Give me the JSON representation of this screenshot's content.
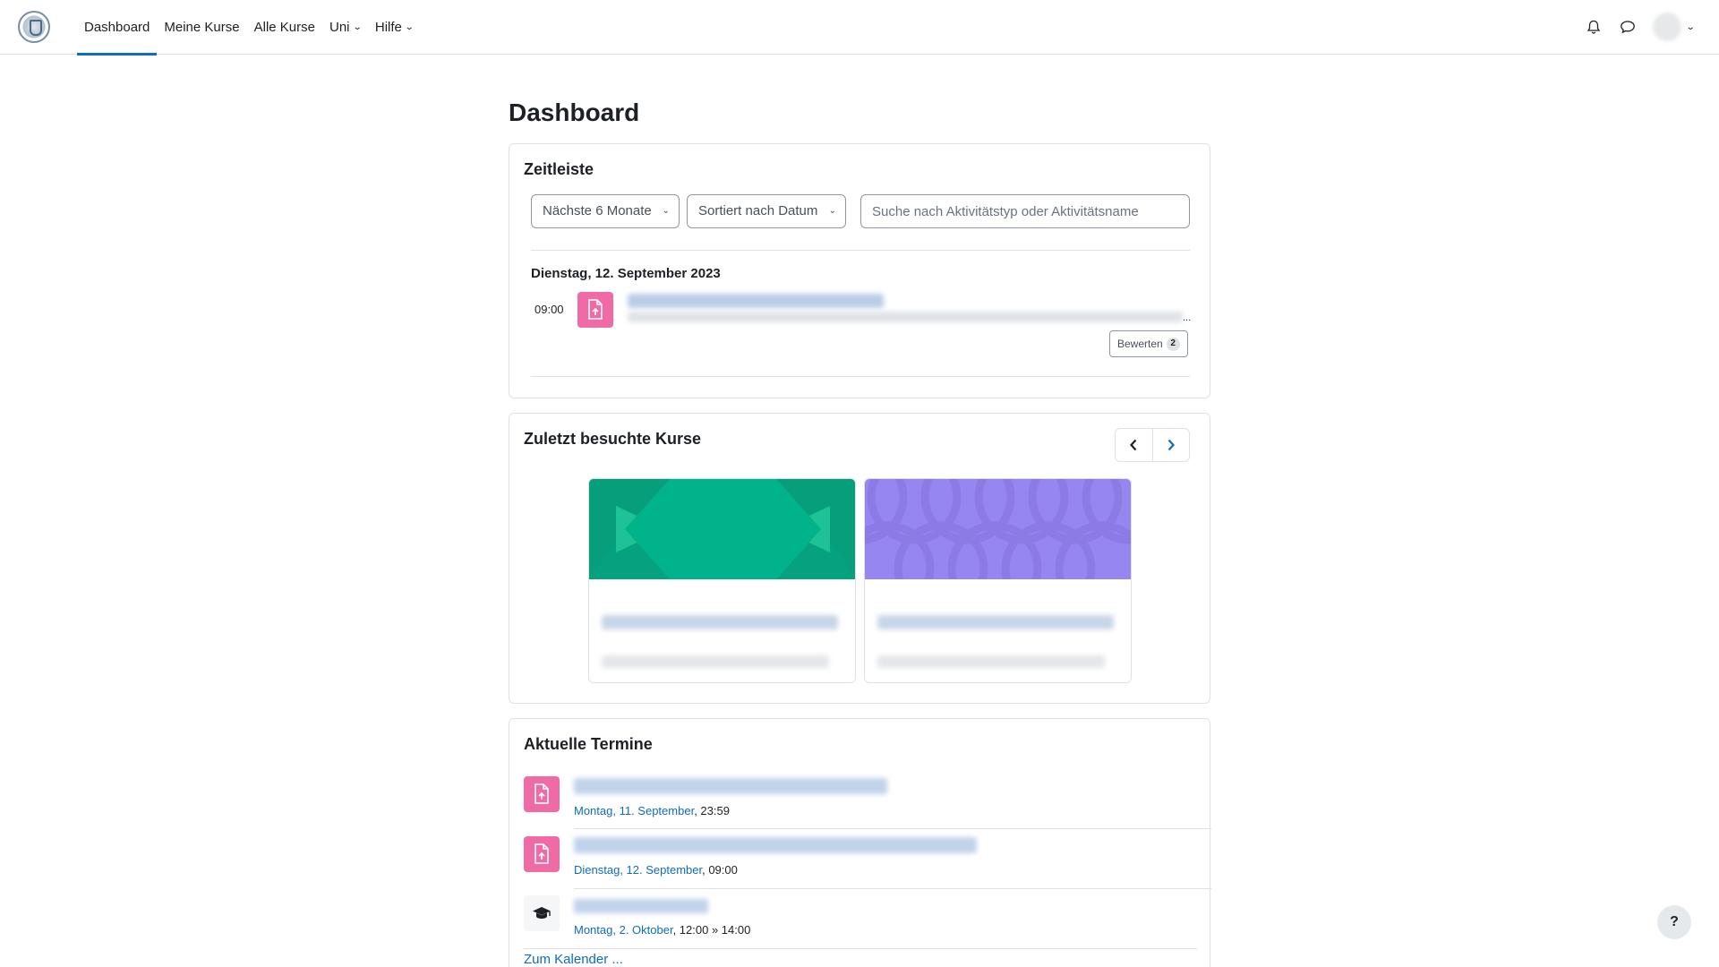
{
  "nav": {
    "logo": "university-seal-logo",
    "links": [
      {
        "label": "Dashboard",
        "active": true,
        "dropdown": false
      },
      {
        "label": "Meine Kurse",
        "active": false,
        "dropdown": false
      },
      {
        "label": "Alle Kurse",
        "active": false,
        "dropdown": false
      },
      {
        "label": "Uni",
        "active": false,
        "dropdown": true
      },
      {
        "label": "Hilfe",
        "active": false,
        "dropdown": true
      }
    ],
    "icons": [
      "bell-icon",
      "chat-icon"
    ]
  },
  "page": {
    "title": "Dashboard"
  },
  "timeline": {
    "title": "Zeitleiste",
    "range_select": "Nächste 6 Monate",
    "sort_select": "Sortiert nach Datum",
    "search_placeholder": "Suche nach Aktivitätstyp oder Aktivitätsname",
    "date_heading": "Dienstag, 12. September 2023",
    "events": [
      {
        "time": "09:00",
        "icon": "assignment-upload-icon",
        "ellipsis": "...",
        "action_label": "Bewerten",
        "action_count": "2"
      }
    ]
  },
  "recent_courses": {
    "title": "Zuletzt besuchte Kurse",
    "courses": [
      {
        "pattern": "hexagon",
        "color": "#00b38a"
      },
      {
        "pattern": "circles",
        "color": "#8f7ef0"
      }
    ]
  },
  "upcoming": {
    "title": "Aktuelle Termine",
    "events": [
      {
        "icon": "assignment-upload-icon",
        "date_link": "Montag, 11. September",
        "time": ", 23:59"
      },
      {
        "icon": "assignment-upload-icon",
        "date_link": "Dienstag, 12. September",
        "time": ", 09:00"
      },
      {
        "icon": "graduation-cap-icon",
        "date_link": "Montag, 2. Oktober",
        "time": ", 12:00 » 14:00"
      }
    ],
    "calendar_link": "Zum Kalender ..."
  },
  "help_button": "?",
  "colors": {
    "accent": "#0f6cbf",
    "assignment": "#f06ba6"
  }
}
